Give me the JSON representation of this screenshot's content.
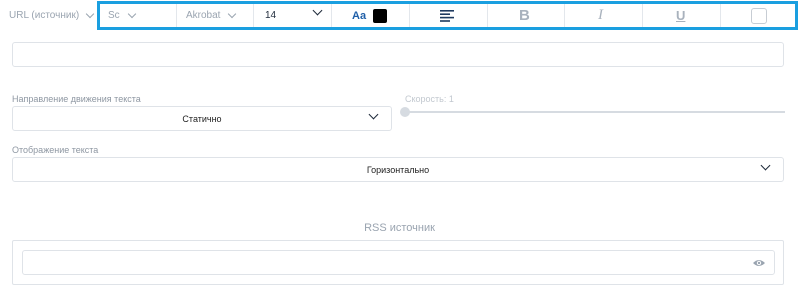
{
  "toolbar": {
    "source_select": "URL (источник)",
    "style_select": "Sc",
    "font_select": "Akrobat",
    "size_select": "14",
    "font_button_label": "Aa",
    "text_color": "#000000",
    "align_icon": "align-left-icon",
    "bold_label": "B",
    "italic_label": "I",
    "underline_label": "U",
    "accent_color": "#1a9fe0"
  },
  "main": {
    "text_input_value": "",
    "direction_label": "Направление движения текста",
    "direction_value": "Статично",
    "speed_label": "Скорость: 1",
    "speed_value": 1,
    "display_label": "Отображение текста",
    "display_value": "Горизонтально",
    "rss_title": "RSS источник",
    "rss_input_value": ""
  }
}
